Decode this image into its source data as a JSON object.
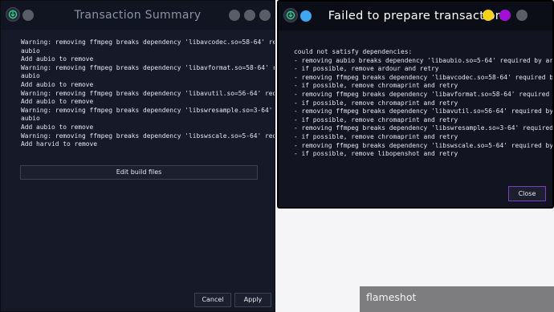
{
  "transaction_window": {
    "title": "Transaction Summary",
    "messages": "Warning: removing ffmpeg breaks dependency 'libavcodec.so=58-64' required by\naubio\nAdd aubio to remove\nWarning: removing ffmpeg breaks dependency 'libavformat.so=58-64' required by\naubio\nAdd aubio to remove\nWarning: removing ffmpeg breaks dependency 'libavutil.so=56-64' required by aubio\nAdd aubio to remove\nWarning: removing ffmpeg breaks dependency 'libswresample.so=3-64' required by\naubio\nAdd aubio to remove\nWarning: removing ffmpeg breaks dependency 'libswscale.so=5-64' required by harvid\nAdd harvid to remove",
    "edit_button": "Edit build files",
    "cancel_button": "Cancel",
    "apply_button": "Apply",
    "dot_color": "#5a5d66"
  },
  "error_window": {
    "title": "Failed to prepare transaction",
    "messages": "could not satisfy dependencies:\n- removing aubio breaks dependency 'libaubio.so=5-64' required by ardour,\n- if possible, remove ardour and retry\n- removing ffmpeg breaks dependency 'libavcodec.so=58-64' required by chromaprint,\n- if possible, remove chromaprint and retry\n- removing ffmpeg breaks dependency 'libavformat.so=58-64' required by chromaprint,\n- if possible, remove chromaprint and retry\n- removing ffmpeg breaks dependency 'libavutil.so=56-64' required by chromaprint,\n- if possible, remove chromaprint and retry\n- removing ffmpeg breaks dependency 'libswresample.so=3-64' required by chromaprint,\n- if possible, remove chromaprint and retry\n- removing ffmpeg breaks dependency 'libswscale.so=5-64' required by libopenshot,\n- if possible, remove libopenshot and retry",
    "close_button": "Close",
    "colors": {
      "blue": "#3ea7f0",
      "yellow": "#f7d21a",
      "purple": "#a30fd6",
      "accent": "#7a3fbf"
    }
  },
  "flameshot_bar": {
    "label": "flameshot"
  }
}
